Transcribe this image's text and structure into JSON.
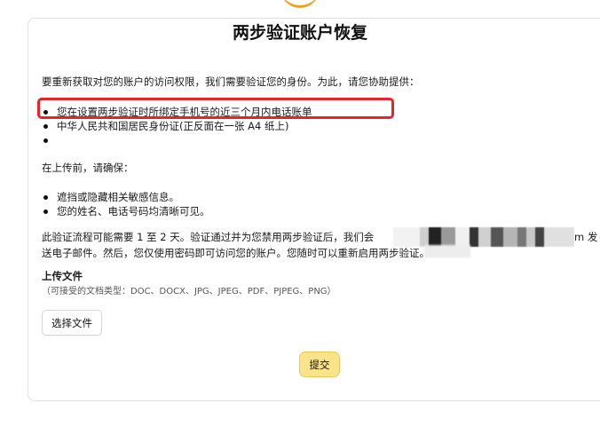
{
  "title": "两步验证账户恢复",
  "intro": "要重新获取对您的账户的访问权限，我们需要验证您的身份。为此，请您协助提供：",
  "required_documents": [
    "您在设置两步验证时所绑定手机号的近三个月内电话账单",
    "中华人民共和国居民身份证(正反面在一张 A4 纸上)",
    ""
  ],
  "before_upload": "在上传前，请确保：",
  "checklist": [
    "遮挡或隐藏相关敏感信息。",
    "您的姓名、电话号码均清晰可见。"
  ],
  "notice_line1_start": "此验证流程可能需要 1 至 2 天。验证通过并为您禁用两步验证后，我们会",
  "notice_line1_end": "m 发",
  "notice_line2": "送电子邮件。然后，您仅使用密码即可访问您的账户。您随时可以重新启用两步验证。",
  "upload": {
    "heading": "上传文件",
    "accepted_types": "（可接受的文档类型：DOC、DOCX、JPG、JPEG、PDF、PJPEG、PNG）",
    "choose_file_label": "选择文件"
  },
  "submit_label": "提交",
  "colors": {
    "highlight": "#e8232a",
    "submit_bg": "#fbe38a",
    "logo_accent": "#f0a020"
  }
}
